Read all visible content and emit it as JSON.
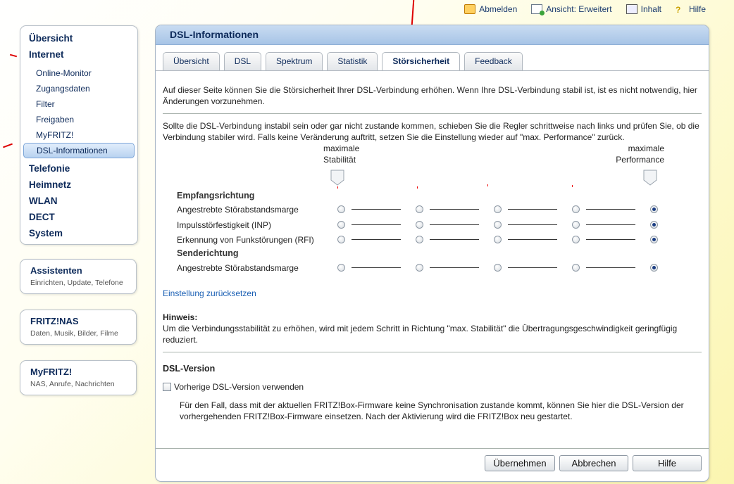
{
  "topbar": {
    "logout": "Abmelden",
    "view": "Ansicht: Erweitert",
    "content": "Inhalt",
    "help": "Hilfe"
  },
  "nav": {
    "overview": "Übersicht",
    "internet": "Internet",
    "internet_items": [
      "Online-Monitor",
      "Zugangsdaten",
      "Filter",
      "Freigaben",
      "MyFRITZ!",
      "DSL-Informationen"
    ],
    "telephony": "Telefonie",
    "homenet": "Heimnetz",
    "wlan": "WLAN",
    "dect": "DECT",
    "system": "System"
  },
  "boxes": [
    {
      "title": "Assistenten",
      "sub": "Einrichten, Update, Telefone"
    },
    {
      "title": "FRITZ!NAS",
      "sub": "Daten, Musik, Bilder, Filme"
    },
    {
      "title": "MyFRITZ!",
      "sub": "NAS, Anrufe, Nachrichten"
    }
  ],
  "panel": {
    "title": "DSL-Informationen",
    "tabs": [
      "Übersicht",
      "DSL",
      "Spektrum",
      "Statistik",
      "Störsicherheit",
      "Feedback"
    ],
    "active_tab": "Störsicherheit",
    "intro": "Auf dieser Seite können Sie die Störsicherheit Ihrer DSL-Verbindung erhöhen. Wenn Ihre DSL-Verbindung stabil ist, ist es nicht notwendig, hier Änderungen vorzunehmen.",
    "instructions": "Sollte die DSL-Verbindung instabil sein oder gar nicht zustande kommen, schieben Sie die Regler schrittweise nach links und prüfen Sie, ob die Verbindung stabiler wird. Falls keine Veränderung auftritt, setzen Sie die Einstellung wieder auf \"max. Performance\" zurück.",
    "slider": {
      "left_label_1": "maximale",
      "left_label_2": "Stabilität",
      "right_label_1": "maximale",
      "right_label_2": "Performance",
      "group_down": "Empfangsrichtung",
      "group_up": "Senderichtung",
      "rows": [
        {
          "label": "Angestrebte Störabstandsmarge",
          "value": 5
        },
        {
          "label": "Impulsstörfestigkeit (INP)",
          "value": 5
        },
        {
          "label": "Erkennung von Funkstörungen (RFI)",
          "value": 5
        },
        {
          "label": "Angestrebte Störabstandsmarge",
          "value": 5
        }
      ],
      "steps": 5
    },
    "reset_link": "Einstellung zurücksetzen",
    "hint_title": "Hinweis:",
    "hint_text": "Um die Verbindungsstabilität zu erhöhen, wird mit jedem Schritt in Richtung \"max. Stabilität\" die Übertragungsgeschwindigkeit geringfügig reduziert.",
    "dsl_version_title": "DSL-Version",
    "checkbox_label": "Vorherige DSL-Version verwenden",
    "checkbox_checked": false,
    "checkbox_desc": "Für den Fall, dass mit der aktuellen FRITZ!Box-Firmware keine Synchronisation zustande kommt, können Sie hier die DSL-Version der vorhergehenden FRITZ!Box-Firmware einsetzen. Nach der Aktivierung wird die FRITZ!Box neu gestartet.",
    "buttons": {
      "apply": "Übernehmen",
      "cancel": "Abbrechen",
      "help": "Hilfe"
    }
  },
  "colors": {
    "accent_blue": "#a7c4e6",
    "nav_text": "#0d2a5a",
    "link": "#1a5fb4",
    "background_yellow": "#fbf5b0"
  }
}
